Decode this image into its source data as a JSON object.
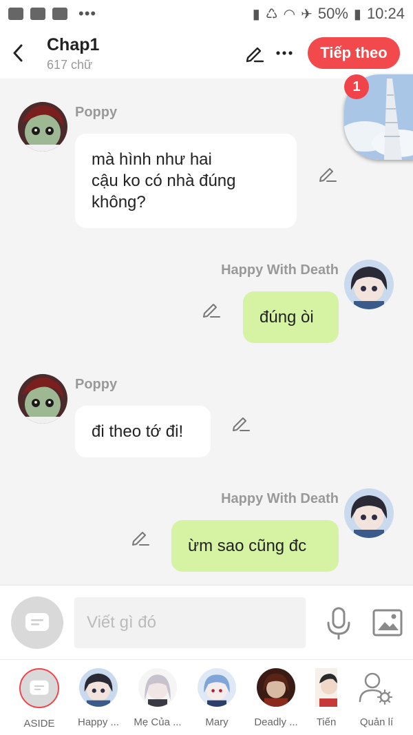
{
  "status_bar": {
    "battery": "50%",
    "time": "10:24"
  },
  "header": {
    "title": "Chap1",
    "subtitle": "617 chữ",
    "next_label": "Tiếp theo"
  },
  "floater": {
    "badge": "1"
  },
  "messages": [
    {
      "sender": "Poppy",
      "text_lines": [
        "mà hình như hai",
        "cậu ko có nhà đúng",
        "không?"
      ]
    },
    {
      "sender": "Happy With Death",
      "text_lines": [
        "đúng òi"
      ]
    },
    {
      "sender": "Poppy",
      "text_lines": [
        "đi theo tớ đi!"
      ]
    },
    {
      "sender": "Happy With Death",
      "text_lines": [
        "ừm sao cũng đc"
      ]
    }
  ],
  "input": {
    "placeholder": "Viết gì đó"
  },
  "characters": [
    {
      "label": "ASIDE"
    },
    {
      "label": "Happy ..."
    },
    {
      "label": "Mẹ Của ..."
    },
    {
      "label": "Mary"
    },
    {
      "label": "Deadly ..."
    },
    {
      "label": "Tiến"
    },
    {
      "label": "Quản lí"
    }
  ],
  "colors": {
    "accent": "#f24a4c",
    "right_bubble": "#d6f3a4",
    "left_bubble": "#ffffff"
  }
}
